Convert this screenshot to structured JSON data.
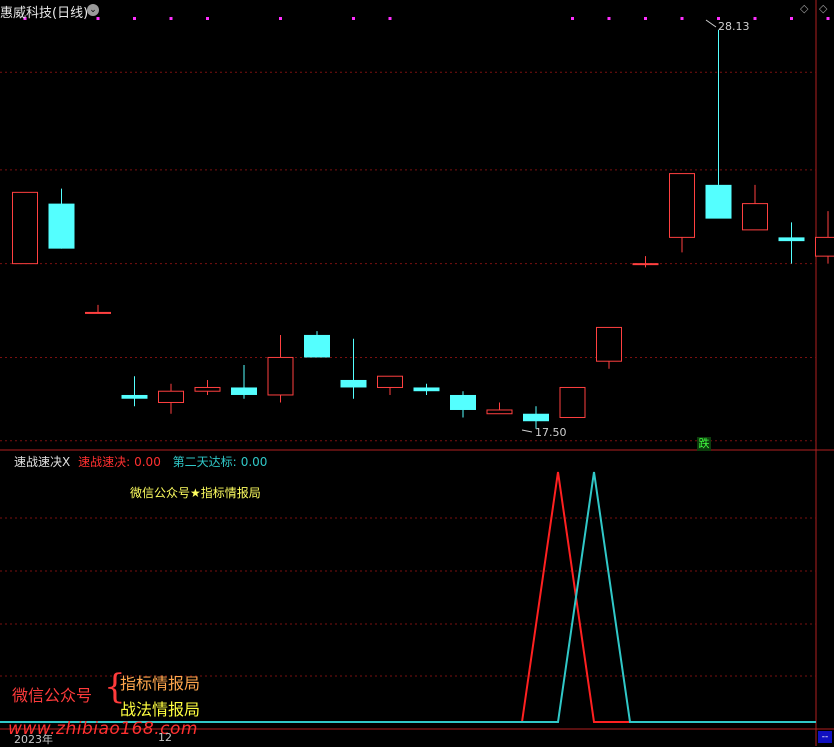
{
  "header": {
    "title": "惠威科技(日线)",
    "high_label": "28.13",
    "low_label": "17.50",
    "signal_badge": "跌"
  },
  "indicator": {
    "name": "速战速决X",
    "line1_name": "速战速决:",
    "line1_value": "0.00",
    "line2_name": "第二天达标:",
    "line2_value": "0.00",
    "watermark_text": "微信公众号★指标情报局"
  },
  "stamp": {
    "left": "微信公众号",
    "right_top": "指标情报局",
    "right_bottom": "战法情报局",
    "site": "www.zhibiao168.com"
  },
  "axis": {
    "year_label": "2023年",
    "month_label": "12"
  },
  "colors": {
    "up": "#ff4040",
    "down": "#54ffff",
    "grid": "#7a1010",
    "line1": "#ff2020",
    "line2": "#30c8c8",
    "marker": "#ff30ff"
  },
  "chart_data": {
    "type": "candlestick",
    "candles": [
      {
        "o": 21.9,
        "h": 23.8,
        "l": 21.9,
        "c": 23.8
      },
      {
        "o": 23.5,
        "h": 23.9,
        "l": 22.3,
        "c": 22.3
      },
      {
        "o": 20.6,
        "h": 20.8,
        "l": 20.6,
        "c": 20.6
      },
      {
        "o": 18.4,
        "h": 18.9,
        "l": 18.1,
        "c": 18.3
      },
      {
        "o": 18.2,
        "h": 18.7,
        "l": 17.9,
        "c": 18.5
      },
      {
        "o": 18.5,
        "h": 18.8,
        "l": 18.4,
        "c": 18.6
      },
      {
        "o": 18.6,
        "h": 19.2,
        "l": 18.3,
        "c": 18.4
      },
      {
        "o": 18.4,
        "h": 20.0,
        "l": 18.2,
        "c": 19.4
      },
      {
        "o": 20.0,
        "h": 20.1,
        "l": 19.5,
        "c": 19.4
      },
      {
        "o": 18.8,
        "h": 19.9,
        "l": 18.3,
        "c": 18.6
      },
      {
        "o": 18.6,
        "h": 18.8,
        "l": 18.4,
        "c": 18.9
      },
      {
        "o": 18.6,
        "h": 18.7,
        "l": 18.4,
        "c": 18.5
      },
      {
        "o": 18.4,
        "h": 18.5,
        "l": 17.8,
        "c": 18.0
      },
      {
        "o": 17.9,
        "h": 18.2,
        "l": 17.9,
        "c": 18.0
      },
      {
        "o": 17.9,
        "h": 18.1,
        "l": 17.5,
        "c": 17.7
      },
      {
        "o": 17.8,
        "h": 18.6,
        "l": 17.8,
        "c": 18.6
      },
      {
        "o": 19.3,
        "h": 20.2,
        "l": 19.1,
        "c": 20.2
      },
      {
        "o": 21.9,
        "h": 22.1,
        "l": 21.8,
        "c": 21.9
      },
      {
        "o": 22.6,
        "h": 24.3,
        "l": 22.2,
        "c": 24.3
      },
      {
        "o": 24.0,
        "h": 28.13,
        "l": 24.0,
        "c": 23.1
      },
      {
        "o": 22.8,
        "h": 24.0,
        "l": 22.8,
        "c": 23.5
      },
      {
        "o": 22.6,
        "h": 23.0,
        "l": 21.9,
        "c": 22.5
      },
      {
        "o": 22.1,
        "h": 23.3,
        "l": 21.9,
        "c": 22.6
      }
    ],
    "indicator_lines": [
      {
        "name": "速战速决",
        "values": [
          0,
          0,
          0,
          0,
          0,
          0,
          0,
          0,
          0,
          0,
          0,
          0,
          0,
          0,
          0,
          0,
          0,
          0,
          0,
          0,
          0,
          0,
          0
        ]
      },
      {
        "name": "第二天达标",
        "values": [
          0,
          0,
          0,
          0,
          0,
          0,
          0,
          0,
          0,
          0,
          0,
          0,
          0,
          0,
          0,
          0,
          0,
          0,
          0,
          0,
          0,
          0,
          0
        ]
      }
    ],
    "ylim": [
      17.2,
      28.5
    ]
  }
}
